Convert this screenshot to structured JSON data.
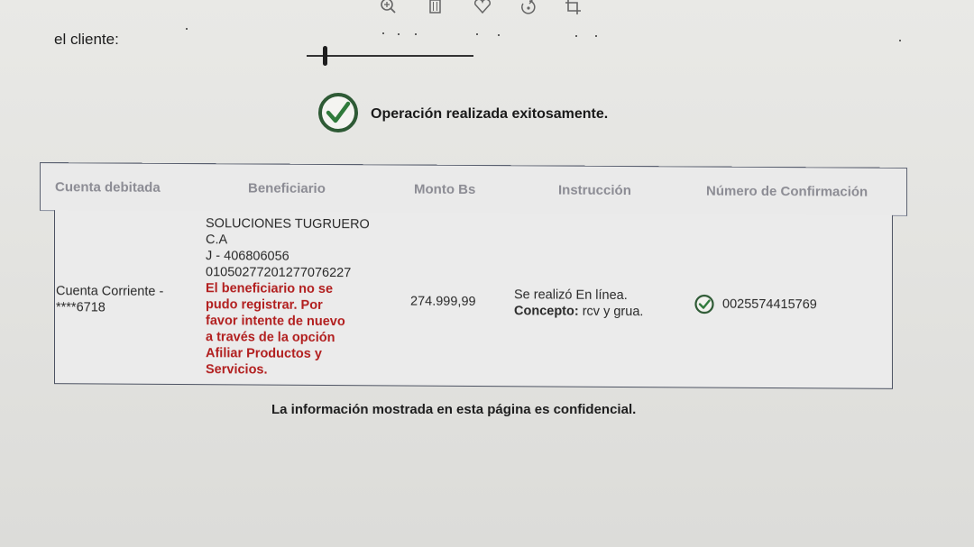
{
  "page": {
    "client_label": "el cliente:",
    "success_message": "Operación realizada exitosamente.",
    "footer_note": "La información mostrada en esta página es confidencial."
  },
  "toolbar_icons": [
    "zoom-in-icon",
    "trash-icon",
    "heart-icon",
    "rotate-icon",
    "crop-icon"
  ],
  "table": {
    "headers": {
      "account": "Cuenta debitada",
      "beneficiary": "Beneficiario",
      "amount": "Monto Bs",
      "instruction": "Instrucción",
      "confirmation": "Número de Confirmación"
    },
    "row": {
      "account_line1": "Cuenta Corriente -",
      "account_line2": "****6718",
      "beneficiary_name1": "SOLUCIONES TUGRUERO",
      "beneficiary_name2": "C.A",
      "beneficiary_rif": "J - 406806056",
      "beneficiary_account": "01050277201277076227",
      "warning_lines": [
        "El beneficiario no se",
        "pudo registrar. Por",
        "favor intente de nuevo",
        "a través de la opción",
        "Afiliar Productos y",
        "Servicios."
      ],
      "amount": "274.999,99",
      "instruction_line1": "Se realizó En línea.",
      "concept_label": "Concepto:",
      "concept_value": "rcv y grua.",
      "confirmation_number": "0025574415769"
    }
  },
  "colors": {
    "success_green": "#2e6b3a",
    "warning_red": "#b21f1f",
    "header_text": "#8c8c94",
    "border": "#4c5262"
  }
}
